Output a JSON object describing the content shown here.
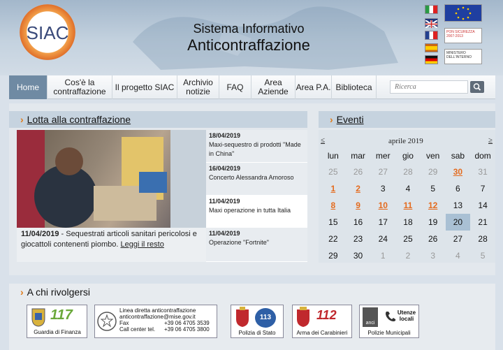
{
  "header": {
    "logo_text": "SIAC",
    "title_line1": "Sistema Informativo",
    "title_line2": "Anticontraffazione",
    "badges": {
      "pon": "PON SICUREZZA 2007-2013",
      "ministero": "MINISTERO DELL'INTERNO"
    }
  },
  "nav": {
    "items": [
      "Home",
      "Cos'è la contraffazione",
      "Il progetto SIAC",
      "Archivio notizie",
      "FAQ",
      "Area Aziende",
      "Area P.A.",
      "Biblioteca"
    ],
    "search_placeholder": "Ricerca"
  },
  "main": {
    "title": "Lotta alla contraffazione",
    "featured": {
      "date": "11/04/2019",
      "text": " - Sequestrati articoli sanitari pericolosi e giocattoli contenenti piombo. ",
      "link": "Leggi il resto"
    },
    "news": [
      {
        "date": "18/04/2019",
        "title": "Maxi-sequestro di prodotti \"Made in China\""
      },
      {
        "date": "16/04/2019",
        "title": "Concerto Alessandra Amoroso"
      },
      {
        "date": "11/04/2019",
        "title": "Maxi operazione in tutta Italia"
      },
      {
        "date": "11/04/2019",
        "title": "Operazione \"Fortnite\""
      }
    ]
  },
  "events": {
    "title": "Eventi",
    "prev": "≤",
    "next": "≥",
    "month": "aprile 2019",
    "weekdays": [
      "lun",
      "mar",
      "mer",
      "gio",
      "ven",
      "sab",
      "dom"
    ],
    "weeks": [
      [
        "25",
        "26",
        "27",
        "28",
        "29",
        "30",
        "31"
      ],
      [
        "1",
        "2",
        "3",
        "4",
        "5",
        "6",
        "7"
      ],
      [
        "8",
        "9",
        "10",
        "11",
        "12",
        "13",
        "14"
      ],
      [
        "15",
        "16",
        "17",
        "18",
        "19",
        "20",
        "21"
      ],
      [
        "22",
        "23",
        "24",
        "25",
        "26",
        "27",
        "28"
      ],
      [
        "29",
        "30",
        "1",
        "2",
        "3",
        "4",
        "5"
      ]
    ]
  },
  "footer": {
    "title": "A chi rivolgersi",
    "gdf": {
      "label": "Guardia di Finanza",
      "number": "117"
    },
    "hotline": {
      "l1": "Linea diretta anticontraffazione",
      "l2": "anticontraffazione@mise.gov.it",
      "l3a": "Fax",
      "l3b": "+39 06 4705 3539",
      "l4a": "Call center tel.",
      "l4b": "+39 06 4705 3800"
    },
    "polizia": {
      "label": "Polizia di Stato",
      "number": "113"
    },
    "carabinieri": {
      "label": "Arma dei Carabinieri",
      "number": "112"
    },
    "municipali": {
      "label": "Polizie Municipali",
      "extra": "Utenze locali",
      "logo": "anci"
    }
  }
}
